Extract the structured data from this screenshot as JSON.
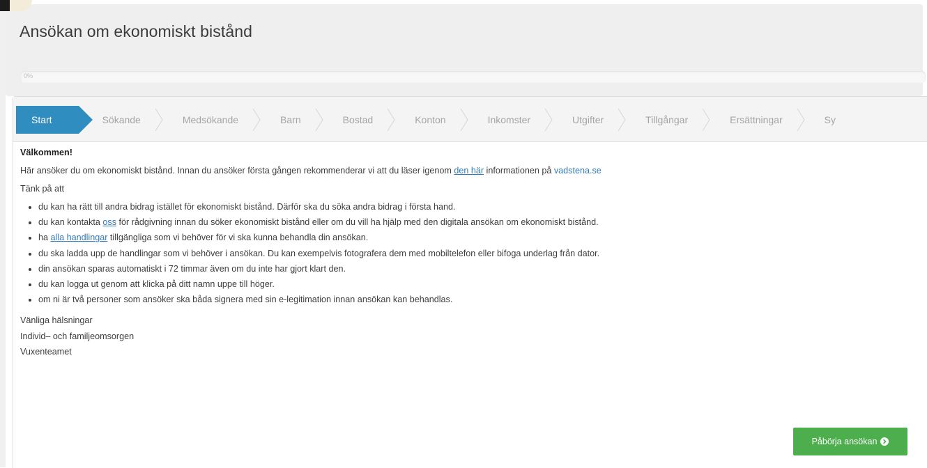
{
  "page": {
    "title": "Ansökan om ekonomiskt bistånd",
    "progress_label": "0%",
    "progress_value": 0
  },
  "steps": [
    {
      "label": "Start",
      "active": true
    },
    {
      "label": "Sökande",
      "active": false
    },
    {
      "label": "Medsökande",
      "active": false
    },
    {
      "label": "Barn",
      "active": false
    },
    {
      "label": "Bostad",
      "active": false
    },
    {
      "label": "Konton",
      "active": false
    },
    {
      "label": "Inkomster",
      "active": false
    },
    {
      "label": "Utgifter",
      "active": false
    },
    {
      "label": "Tillgångar",
      "active": false
    },
    {
      "label": "Ersättningar",
      "active": false
    },
    {
      "label": "Sy",
      "active": false
    }
  ],
  "content": {
    "welcome": "Välkommen!",
    "intro": {
      "before": "Här ansöker du om ekonomiskt bistånd. Innan du ansöker första gången rekommenderar vi att du läser igenom ",
      "link_text": "den här",
      "middle": " informationen på ",
      "site_link": "vadstena.se"
    },
    "think": "Tänk på att",
    "tips": [
      {
        "text": "du kan ha rätt till andra bidrag istället för ekonomiskt bistånd. Därför ska du söka andra bidrag i första hand."
      },
      {
        "before": "du kan kontakta ",
        "link": "oss",
        "after": " för rådgivning innan du söker ekonomiskt bistånd eller om du vill ha hjälp med den digitala ansökan om ekonomiskt bistånd."
      },
      {
        "before": "ha ",
        "link": "alla handlingar",
        "after": " tillgängliga som vi behöver för vi ska kunna behandla din ansökan."
      },
      {
        "text": "du ska ladda upp de handlingar som vi behöver i ansökan. Du kan exempelvis fotografera dem med mobiltelefon eller bifoga underlag från dator."
      },
      {
        "text": "din ansökan sparas automatiskt i 72 timmar även om du inte har gjort klart den."
      },
      {
        "text": "du kan logga ut genom att klicka på ditt namn uppe till höger."
      },
      {
        "text": "om ni är två personer som ansöker ska båda signera med sin e-legitimation innan ansökan kan behandlas."
      }
    ],
    "regards": [
      "Vänliga hälsningar",
      "Individ– och familjeomsorgen",
      "Vuxenteamet"
    ]
  },
  "actions": {
    "start_label": "Påbörja ansökan",
    "start_icon": "circle-arrow-right-icon"
  },
  "colors": {
    "accent": "#2f8dbf",
    "button": "#4cae4c",
    "link": "#337ab7",
    "header_bg": "#efefef"
  }
}
